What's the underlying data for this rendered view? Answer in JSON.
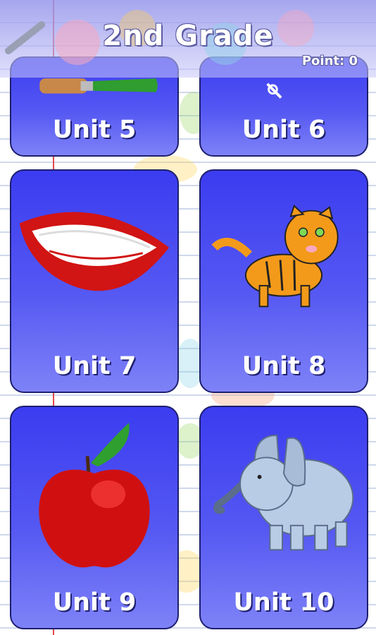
{
  "header": {
    "title": "2nd  Grade",
    "points": "Point: 0"
  },
  "units": [
    {
      "label": "Unit 5",
      "icon": "paintbrush-icon"
    },
    {
      "label": "Unit 6",
      "icon": "scissors-icon"
    },
    {
      "label": "Unit 7",
      "icon": "mouth-icon"
    },
    {
      "label": "Unit 8",
      "icon": "tiger-icon"
    },
    {
      "label": "Unit 9",
      "icon": "apple-icon"
    },
    {
      "label": "Unit 10",
      "icon": "elephant-icon"
    }
  ],
  "colors": {
    "card_top": "#3b3cf0",
    "card_bottom": "#7e82f7",
    "card_border": "#1d1f6e",
    "paper_margin": "#e2474f"
  }
}
